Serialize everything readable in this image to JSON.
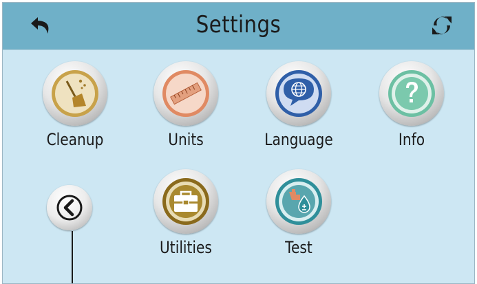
{
  "header": {
    "title": "Settings",
    "back_icon": "back-arrow-icon",
    "refresh_icon": "refresh-icon"
  },
  "tiles": [
    {
      "label": "Cleanup",
      "icon": "broom-icon",
      "color": "#c8a24a"
    },
    {
      "label": "Units",
      "icon": "ruler-icon",
      "color": "#e08a63"
    },
    {
      "label": "Language",
      "icon": "globe-speech-icon",
      "color": "#2f5fa8"
    },
    {
      "label": "Info",
      "icon": "question-mark-icon",
      "color": "#6cc0a3"
    },
    {
      "label": "Utilities",
      "icon": "toolbox-icon",
      "color": "#8a6a1c"
    },
    {
      "label": "Test",
      "icon": "water-test-icon",
      "color": "#2f8f9a"
    }
  ],
  "pager": {
    "icon": "chevron-left-icon"
  },
  "colors": {
    "header": "#6fb0c8",
    "background": "#cde7f3"
  }
}
